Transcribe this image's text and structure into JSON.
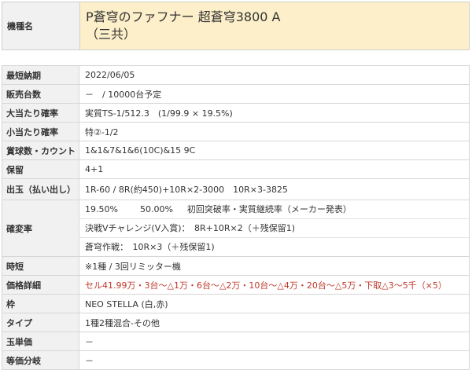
{
  "machine": {
    "label": "機種名",
    "name_line1": "P蒼穹のファフナー 超蒼穹3800 A",
    "name_line2": "（三共）"
  },
  "specs": [
    {
      "label": "最短納期",
      "value": "2022/06/05"
    },
    {
      "label": "販売台数",
      "value": "－　/ 10000台予定"
    },
    {
      "label": "大当たり確率",
      "value": "実質TS-1/512.3　(1/99.9 × 19.5%)"
    },
    {
      "label": "小当たり確率",
      "value": "特②-1/2"
    },
    {
      "label": "賞球数・カウント",
      "value": "1&1&7&1&6(10C)&15 9C"
    },
    {
      "label": "保留",
      "value": "4+1"
    },
    {
      "label": "出玉（払い出し）",
      "value": "1R-60 / 8R(約450)+10R×2-3000　10R×3-3825"
    },
    {
      "label": "確変率",
      "lines": [
        {
          "a": "19.50%",
          "b": "50.00%",
          "c": "初回突破率・実質継続率（メーカー発表）"
        },
        {
          "text": "決戦Vチャレンジ(V入賞)：　8R+10R×2（＋残保留1)"
        },
        {
          "text": "蒼穹作戦：　10R×3（＋残保留1)"
        }
      ]
    },
    {
      "label": "時短",
      "value": "※1種 / 3回リミッター機"
    },
    {
      "label": "価格詳細",
      "value": "セル41.99万・3台～△1万・6台～△2万・10台～△4万・20台～△5万・下取△3～5千（×5）",
      "color": "#c0392b"
    },
    {
      "label": "枠",
      "value": "NEO STELLA (白,赤)"
    },
    {
      "label": "タイプ",
      "value": "1種2種混合-その他"
    },
    {
      "label": "玉単価",
      "value": "－"
    },
    {
      "label": "等価分岐",
      "value": "－"
    }
  ]
}
